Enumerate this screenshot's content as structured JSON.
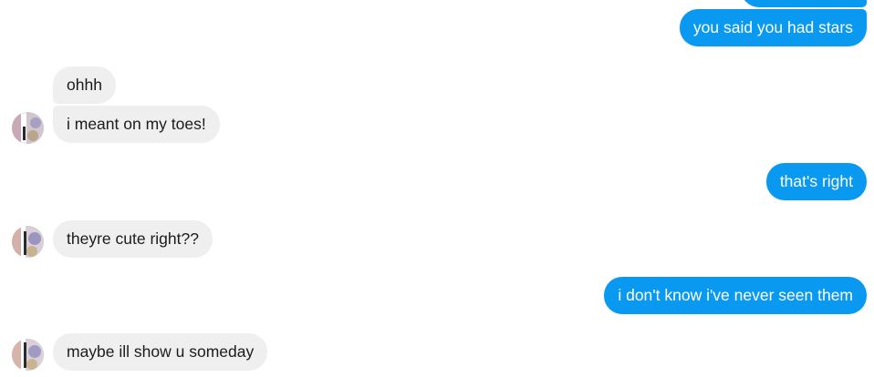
{
  "conversation": {
    "messages": [
      {
        "direction": "outgoing",
        "text": ""
      },
      {
        "direction": "outgoing",
        "text": "you said you had stars"
      },
      {
        "direction": "incoming",
        "text": "ohhh"
      },
      {
        "direction": "incoming",
        "text": "i meant on my toes!"
      },
      {
        "direction": "outgoing",
        "text": "that's right"
      },
      {
        "direction": "incoming",
        "text": "theyre cute right??"
      },
      {
        "direction": "outgoing",
        "text": "i don't know i've never seen them"
      },
      {
        "direction": "incoming",
        "text": "maybe ill show u someday"
      }
    ]
  },
  "colors": {
    "outgoing_bubble": "#0a99f0",
    "incoming_bubble": "#efefef",
    "outgoing_text": "#ffffff",
    "incoming_text": "#1b1b1b"
  },
  "icons": {
    "avatar": "contact-avatar-photo"
  }
}
